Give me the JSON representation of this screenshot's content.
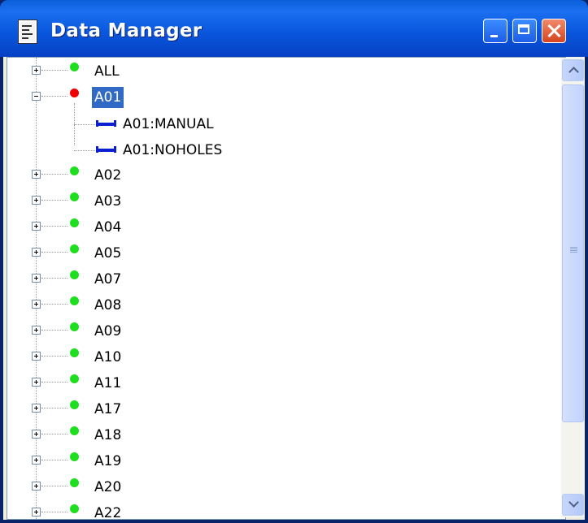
{
  "window": {
    "title": "Data Manager",
    "icon": "data-manager-icon",
    "controls": [
      "minimize-icon",
      "maximize-icon",
      "close-icon"
    ]
  },
  "tree": {
    "items": [
      {
        "label": "ALL",
        "status": "green",
        "expanded": false
      },
      {
        "label": "A01",
        "status": "red",
        "expanded": true,
        "selected": true,
        "children": [
          {
            "label": "A01:MANUAL",
            "icon": "segment-icon"
          },
          {
            "label": "A01:NOHOLES",
            "icon": "segment-icon"
          }
        ]
      },
      {
        "label": "A02",
        "status": "green",
        "expanded": false
      },
      {
        "label": "A03",
        "status": "green",
        "expanded": false
      },
      {
        "label": "A04",
        "status": "green",
        "expanded": false
      },
      {
        "label": "A05",
        "status": "green",
        "expanded": false
      },
      {
        "label": "A07",
        "status": "green",
        "expanded": false
      },
      {
        "label": "A08",
        "status": "green",
        "expanded": false
      },
      {
        "label": "A09",
        "status": "green",
        "expanded": false
      },
      {
        "label": "A10",
        "status": "green",
        "expanded": false
      },
      {
        "label": "A11",
        "status": "green",
        "expanded": false
      },
      {
        "label": "A17",
        "status": "green",
        "expanded": false
      },
      {
        "label": "A18",
        "status": "green",
        "expanded": false
      },
      {
        "label": "A19",
        "status": "green",
        "expanded": false
      },
      {
        "label": "A20",
        "status": "green",
        "expanded": false
      },
      {
        "label": "A22",
        "status": "green",
        "expanded": false
      }
    ]
  },
  "colors": {
    "selection": "#316ac5",
    "status_green": "#1fdd1f",
    "status_red": "#f00000",
    "segment_blue": "#0a1fd0"
  }
}
